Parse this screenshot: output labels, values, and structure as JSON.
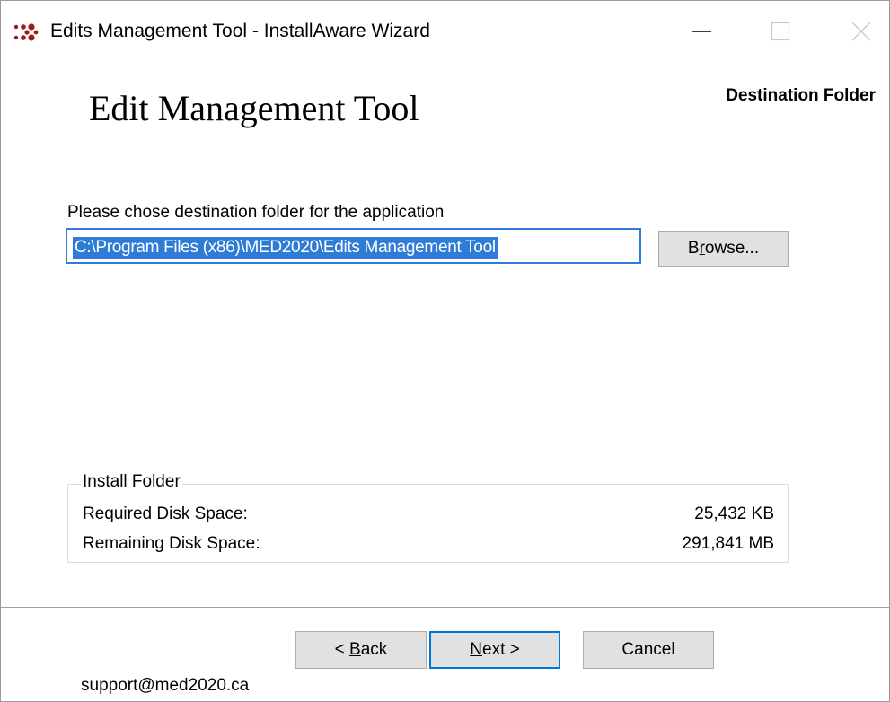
{
  "window": {
    "title": "Edits Management Tool - InstallAware Wizard",
    "icon": "installaware-dots-icon"
  },
  "header": {
    "product_title": "Edit Management Tool",
    "step_title": "Destination Folder"
  },
  "destination": {
    "prompt": "Please chose destination folder for the application",
    "path_value": "C:\\Program Files (x86)\\MED2020\\Edits Management Tool",
    "browse_prefix": "B",
    "browse_mnemonic": "r",
    "browse_suffix": "owse..."
  },
  "install_folder": {
    "legend": "Install Folder",
    "required_label": "Required Disk Space:",
    "required_value": "25,432 KB",
    "remaining_label": "Remaining Disk Space:",
    "remaining_value": "291,841 MB"
  },
  "footer": {
    "back_prefix": "< ",
    "back_mnemonic": "B",
    "back_suffix": "ack",
    "next_mnemonic": "N",
    "next_suffix": "ext >",
    "cancel_label": "Cancel",
    "support_text": "support@med2020.ca"
  },
  "colors": {
    "selection": "#2f7cd6",
    "default_button_border": "#0078d7",
    "button_face": "#e1e1e1",
    "logo_red": "#9b1b1b"
  }
}
